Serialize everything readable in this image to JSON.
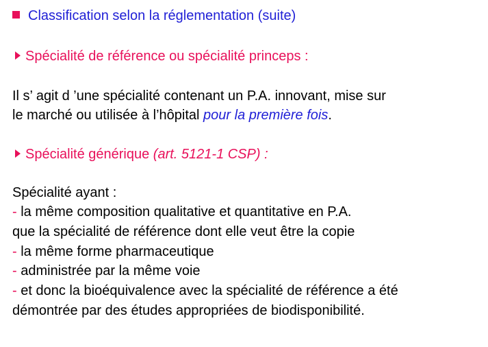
{
  "title": "Classification selon la réglementation (suite)",
  "section1": {
    "heading": "Spécialité de référence ou spécialité princeps :",
    "line1": "Il s’ agit d ’une spécialité contenant un P.A. innovant, mise sur",
    "line2_plain": "le marché ou utilisée à l’hôpital ",
    "line2_emphasis": "pour la première fois",
    "line2_end": "."
  },
  "section2": {
    "heading": "Spécialité générique ",
    "heading_ref": "(art. 5121-1 CSP) :",
    "intro": "Spécialité ayant :",
    "items": [
      {
        "dash": "- ",
        "text": "la même composition qualitative et quantitative en P.A."
      },
      {
        "dash": "",
        "text": "que la spécialité de référence dont elle veut être la copie"
      },
      {
        "dash": "- ",
        "text": "la même forme pharmaceutique"
      },
      {
        "dash": "- ",
        "text": "administrée par la même voie"
      },
      {
        "dash": "- ",
        "text": "et donc la bioéquivalence avec la spécialité de référence a été"
      },
      {
        "dash": "",
        "text": "démontrée par des études appropriées de biodisponibilité."
      }
    ]
  },
  "colors": {
    "title": "#1f1fd6",
    "accent": "#e8105a",
    "text": "#000000"
  },
  "icons": {
    "title_bullet": "square-bullet",
    "section_bullet": "triangle-right-bullet"
  }
}
